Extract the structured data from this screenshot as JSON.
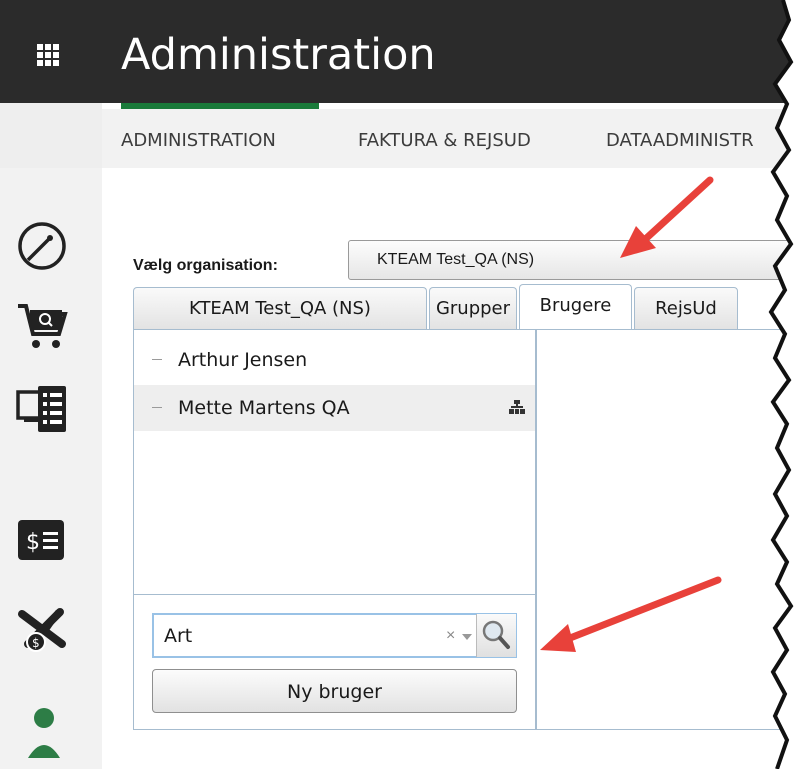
{
  "header": {
    "title": "Administration",
    "apps_icon": "apps-grid-icon"
  },
  "nav": {
    "items": [
      "ADMINISTRATION",
      "FAKTURA & REJSUD",
      "DATAADMINISTR"
    ]
  },
  "sidebar": {
    "icons": [
      "dashboard-gauge-icon",
      "shopping-cart-icon",
      "devices-list-icon",
      "invoice-dollar-icon",
      "travel-expense-plane-icon",
      "user-icon"
    ]
  },
  "org": {
    "label": "Vælg organisation:",
    "selected": "KTEAM Test_QA (NS)"
  },
  "tabs": [
    "KTEAM Test_QA (NS)",
    "Grupper",
    "Brugere",
    "RejsUd"
  ],
  "users": [
    "Arthur Jensen",
    "Mette Martens QA"
  ],
  "search": {
    "value": "Art",
    "clear": "×"
  },
  "new_user_button": "Ny bruger",
  "colors": {
    "topbar": "#2b2b2b",
    "accent_green": "#1a7a3a",
    "panel_border": "#a6bccf",
    "arrow": "#e8413a"
  }
}
